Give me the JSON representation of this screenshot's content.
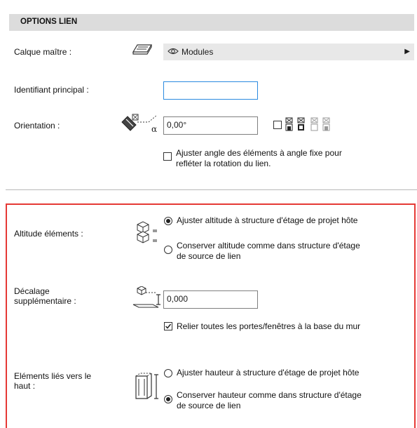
{
  "header": {
    "title": "OPTIONS LIEN"
  },
  "calque": {
    "label": "Calque maître :",
    "icon": "layer-icon",
    "value": "Modules"
  },
  "identifiant": {
    "label": "Identifiant principal :",
    "value": ""
  },
  "orientation": {
    "label": "Orientation :",
    "value": "0,00°",
    "ajuster_label_line1": "Ajuster angle des éléments à angle fixe pour",
    "ajuster_label_line2": "refléter la rotation du lien.",
    "ajuster_checked": false,
    "toggle_checked": false
  },
  "altitude": {
    "label": "Altitude éléments :",
    "options": [
      {
        "line1": "Ajuster altitude à structure d'étage de projet hôte",
        "line2": "",
        "selected": true
      },
      {
        "line1": "Conserver altitude comme dans structure d'étage",
        "line2": "de source de lien",
        "selected": false
      }
    ]
  },
  "decalage": {
    "label_line1": "Décalage",
    "label_line2": "supplémentaire :",
    "value": "0,000",
    "relier_label": "Relier toutes les portes/fenêtres à la base du mur",
    "relier_checked": true
  },
  "elements_lies": {
    "label_line1": "Eléments liés vers le",
    "label_line2": "haut :",
    "options": [
      {
        "line1": "Ajuster hauteur à structure d'étage de projet hôte",
        "line2": "",
        "selected": false
      },
      {
        "line1": "Conserver hauteur comme dans structure d'étage",
        "line2": "de source de lien",
        "selected": true
      }
    ]
  },
  "colors": {
    "highlight_border": "#e53935",
    "focus_border": "#2b8ae0",
    "header_bg": "#dcdcdc"
  }
}
